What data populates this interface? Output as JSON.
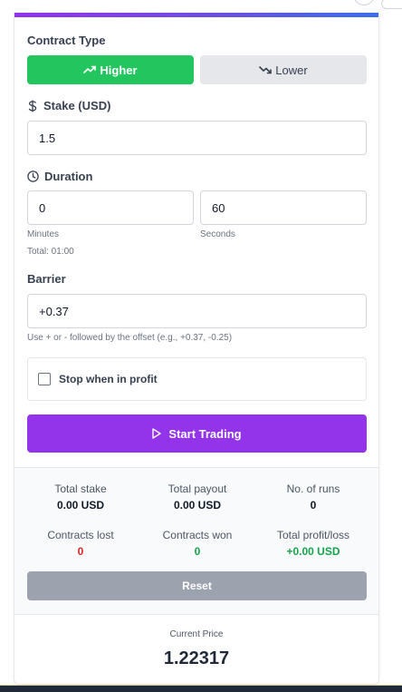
{
  "contract": {
    "label": "Contract Type",
    "higher_label": "Higher",
    "lower_label": "Lower"
  },
  "stake": {
    "label": "Stake (USD)",
    "value": "1.5"
  },
  "duration": {
    "label": "Duration",
    "minutes_value": "0",
    "seconds_value": "60",
    "minutes_label": "Minutes",
    "seconds_label": "Seconds",
    "total": "Total: 01:00"
  },
  "barrier": {
    "label": "Barrier",
    "value": "+0.37",
    "hint": "Use + or - followed by the offset (e.g., +0.37, -0.25)"
  },
  "stop_profit": {
    "label": "Stop when in profit",
    "checked": false
  },
  "start_button": {
    "label": "Start Trading"
  },
  "stats": {
    "total_stake_label": "Total stake",
    "total_stake_value": "0.00 USD",
    "total_payout_label": "Total payout",
    "total_payout_value": "0.00 USD",
    "runs_label": "No. of runs",
    "runs_value": "0",
    "lost_label": "Contracts lost",
    "lost_value": "0",
    "won_label": "Contracts won",
    "won_value": "0",
    "profit_label": "Total profit/loss",
    "profit_value": "+0.00 USD"
  },
  "reset_button": {
    "label": "Reset"
  },
  "price": {
    "label": "Current Price",
    "value": "1.22317"
  },
  "colors": {
    "higher": "#22c55e",
    "lower": "#e5e7eb",
    "start": "#9333ea",
    "reset": "#9ca3af",
    "loss": "#dc2626",
    "profit": "#16a34a"
  }
}
